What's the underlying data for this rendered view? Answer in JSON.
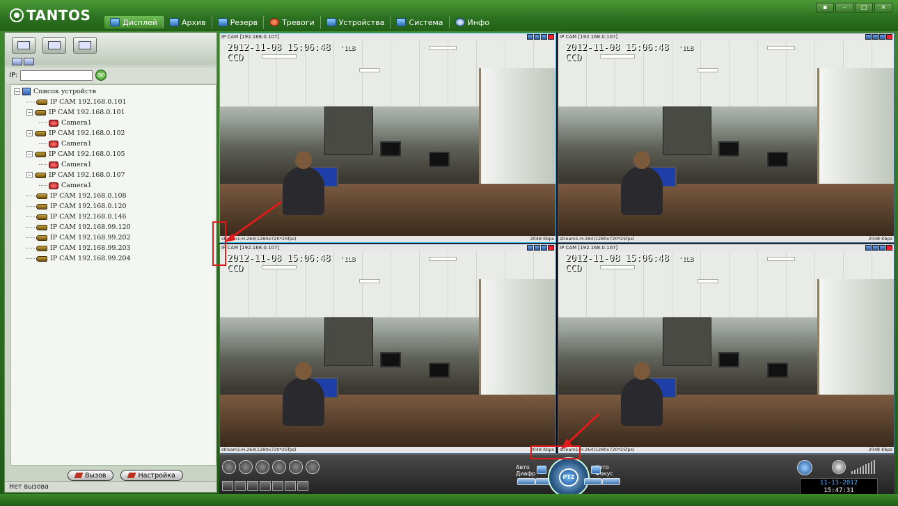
{
  "app": {
    "logo_text": "TANTOS",
    "window_controls": [
      "▪",
      "–",
      "□",
      "×"
    ]
  },
  "menu": [
    {
      "label": "Дисплей",
      "icon": "display-icon",
      "active": true
    },
    {
      "label": "Архив",
      "icon": "archive-icon"
    },
    {
      "label": "Резерв",
      "icon": "backup-icon"
    },
    {
      "label": "Тревоги",
      "icon": "alarm-icon"
    },
    {
      "label": "Устройства",
      "icon": "devices-icon"
    },
    {
      "label": "Система",
      "icon": "system-icon"
    },
    {
      "label": "Инфо",
      "icon": "info-icon"
    }
  ],
  "left_panel": {
    "ip_label": "IP:",
    "ip_value": "",
    "go_label": "GO",
    "tree": [
      {
        "level": 0,
        "label": "Список устройств",
        "type": "root",
        "expander": "−"
      },
      {
        "level": 1,
        "label": "IP CAM 192.168.0.101",
        "type": "cam"
      },
      {
        "level": 1,
        "label": "IP CAM 192.168.0.101",
        "type": "cam",
        "expander": "−"
      },
      {
        "level": 2,
        "label": "Camera1",
        "type": "camera"
      },
      {
        "level": 1,
        "label": "IP CAM 192.168.0.102",
        "type": "cam",
        "expander": "−"
      },
      {
        "level": 2,
        "label": "Camera1",
        "type": "camera"
      },
      {
        "level": 1,
        "label": "IP CAM 192.168.0.105",
        "type": "cam",
        "expander": "−"
      },
      {
        "level": 2,
        "label": "Camera1",
        "type": "camera"
      },
      {
        "level": 1,
        "label": "IP CAM 192.168.0.107",
        "type": "cam",
        "expander": "−"
      },
      {
        "level": 2,
        "label": "Camera1",
        "type": "camera"
      },
      {
        "level": 1,
        "label": "IP CAM 192.168.0.108",
        "type": "cam"
      },
      {
        "level": 1,
        "label": "IP CAM 192.168.0.120",
        "type": "cam"
      },
      {
        "level": 1,
        "label": "IP CAM 192.168.0.146",
        "type": "cam"
      },
      {
        "level": 1,
        "label": "IP CAM 192.168.99.120",
        "type": "cam"
      },
      {
        "level": 1,
        "label": "IP CAM 192.168.99.202",
        "type": "cam"
      },
      {
        "level": 1,
        "label": "IP CAM 192.168.99.203",
        "type": "cam"
      },
      {
        "level": 1,
        "label": "IP CAM 192.168.99.204",
        "type": "cam"
      }
    ],
    "call_button": "Вызов",
    "settings_button": "Настройка",
    "status": "Нет вызова"
  },
  "cells": [
    {
      "title": "IP CAM [192.168.0.107]",
      "osd_date": "2012-11-08 15:06:48",
      "osd_extra": "'1LB",
      "osd_sub": "CCD",
      "stream": "stream1:H.264(1280x720*25fps)",
      "bitrate": "2048 Kbps"
    },
    {
      "title": "IP CAM [192.168.0.107]",
      "osd_date": "2012-11-08 15:06:48",
      "osd_extra": "'1LB",
      "osd_sub": "CCD",
      "stream": "stream1:H.264(1280x720*25fps)",
      "bitrate": "2048 Kbps"
    },
    {
      "title": "IP CAM [192.168.0.107]",
      "osd_date": "2012-11-08 15:06:48",
      "osd_extra": "'1LB",
      "osd_sub": "CCD",
      "stream": "stream1:H.264(1280x720*25fps)",
      "bitrate": "2048 Kbps"
    },
    {
      "title": "IP CAM [192.168.0.107]",
      "osd_date": "2012-11-08 15:06:48",
      "osd_extra": "'1LB",
      "osd_sub": "CCD",
      "stream": "stream1:H.264(1280x720*25fps)",
      "bitrate": "2048 Kbps"
    }
  ],
  "ptz": {
    "center_label": "PTZ",
    "auto_iris": "Авто\nДиафр",
    "auto_focus": "Авто\nФокус"
  },
  "clock": {
    "date": "11-13-2012",
    "time": "15:47:31"
  },
  "colors": {
    "brand_green": "#2b7020",
    "selection_blue": "#34b6e6",
    "annotation_red": "#e01b1b"
  }
}
